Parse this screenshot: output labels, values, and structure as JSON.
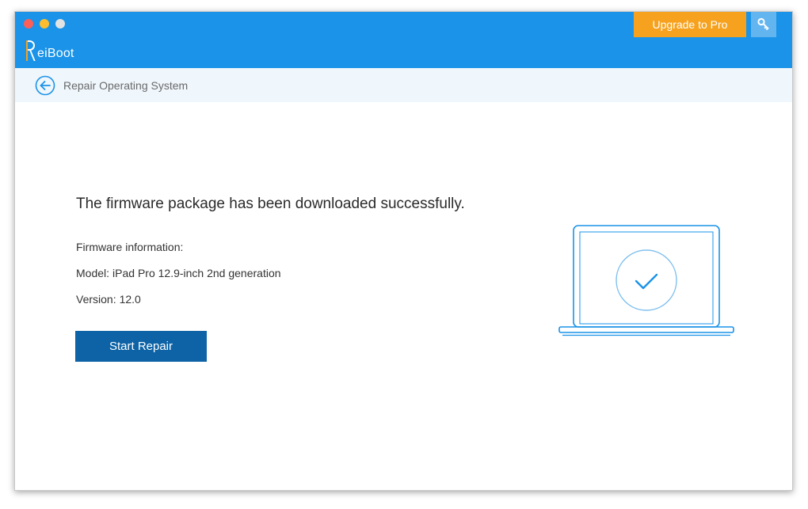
{
  "app": {
    "name": "ReiBoot",
    "logo_rest": "eiBoot",
    "accent": "#1a93e8",
    "upgrade_color": "#f6a21e"
  },
  "header": {
    "upgrade_label": "Upgrade to Pro",
    "key_icon": "key-icon"
  },
  "subbar": {
    "back_icon": "arrow-left-circle-icon",
    "title": "Repair Operating System"
  },
  "main": {
    "headline": "The firmware package has been downloaded successfully.",
    "firmware_label": "Firmware information:",
    "model_label": "Model:",
    "model_value": "iPad Pro 12.9-inch 2nd generation",
    "version_label": "Version:",
    "version_value": "12.0",
    "start_label": "Start Repair",
    "illustration_icon": "laptop-check-icon"
  }
}
